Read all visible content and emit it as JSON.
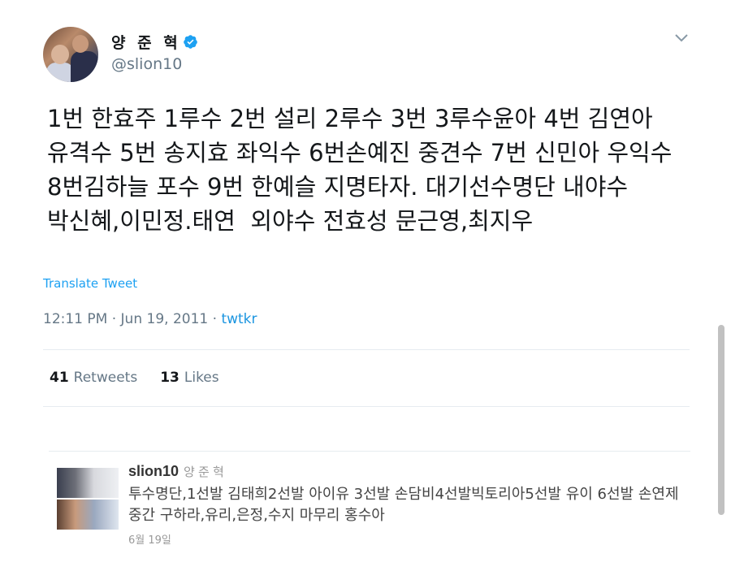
{
  "tweet": {
    "display_name": "양 준 혁",
    "handle": "@slion10",
    "text": "1번 한효주 1루수 2번 설리 2루수 3번 3루수윤아 4번 김연아 유격수 5번 송지효 좌익수 6번손예진 중견수 7번 신민아 우익수 8번김하늘 포수 9번 한예슬 지명타자. 대기선수명단 내야수 박신혜,이민정.태연  외야수 전효성 문근영,최지우",
    "translate_label": "Translate Tweet",
    "time": "12:11 PM",
    "date": "Jun 19, 2011",
    "source": "twtkr",
    "retweets_count": "41",
    "retweets_label": "Retweets",
    "likes_count": "13",
    "likes_label": "Likes"
  },
  "embedded_tweet": {
    "username": "slion10",
    "real_name": "양 준 혁",
    "text": "투수명단,1선발 김태희2선발 아이유 3선발 손담비4선발빅토리아5선발 유이 6선발 손연제 중간 구하라,유리,은정,수지 마무리 홍수아",
    "date": "6월 19일"
  },
  "colors": {
    "verified": "#1da1f2",
    "link": "#1b95e0",
    "secondary_text": "#657786"
  },
  "icons": {
    "verified": "verified-badge-icon",
    "caret": "chevron-down-icon"
  }
}
